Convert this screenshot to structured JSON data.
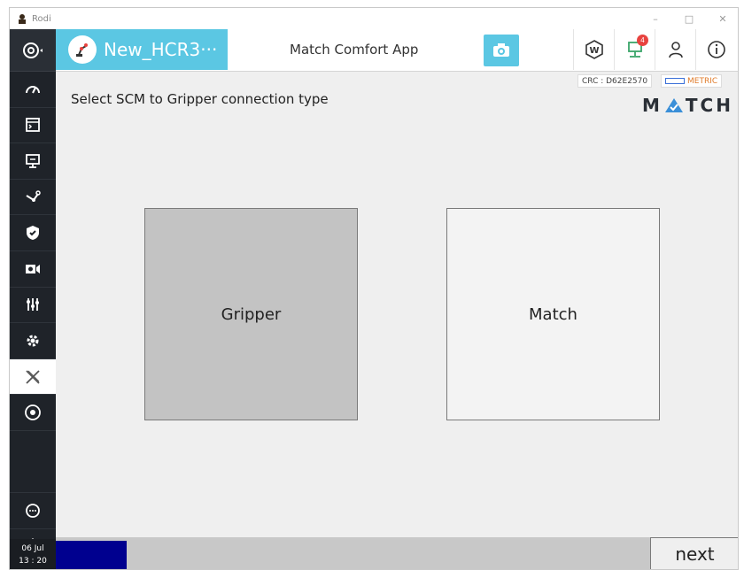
{
  "window": {
    "title": "Rodi",
    "controls": [
      "–",
      "□",
      "✕"
    ]
  },
  "header": {
    "robot_name": "New_HCR3···",
    "app_title": "Match Comfort App",
    "notification_count": "4",
    "icons": [
      "camera-icon",
      "w-badge-icon",
      "network-icon",
      "user-icon",
      "info-icon"
    ]
  },
  "sidebar": {
    "items": [
      "speed-gauge-icon",
      "terminal-icon",
      "monitor-icon",
      "robot-arm-icon",
      "shield-icon",
      "camera-video-icon",
      "sliders-icon",
      "gear-icon",
      "x-app-icon",
      "disc-icon",
      "chat-icon",
      "joystick-icon"
    ],
    "active": "x-app-icon",
    "date": "06 Jul",
    "time": "13 : 20"
  },
  "status": {
    "crc": "CRC : D62E2570",
    "unit": "METRIC"
  },
  "main": {
    "prompt": "Select SCM to Gripper connection type",
    "logo": {
      "left": "M",
      "right": "TCH"
    },
    "options": [
      {
        "label": "Gripper",
        "selected": true
      },
      {
        "label": "Match",
        "selected": false
      }
    ]
  },
  "footer": {
    "next_label": "next",
    "progress_color": "#00008f"
  },
  "colors": {
    "accent": "#5bc7e3",
    "sidebar": "#1f2329",
    "badge": "#e8433f",
    "metric": "#e07b2a"
  }
}
